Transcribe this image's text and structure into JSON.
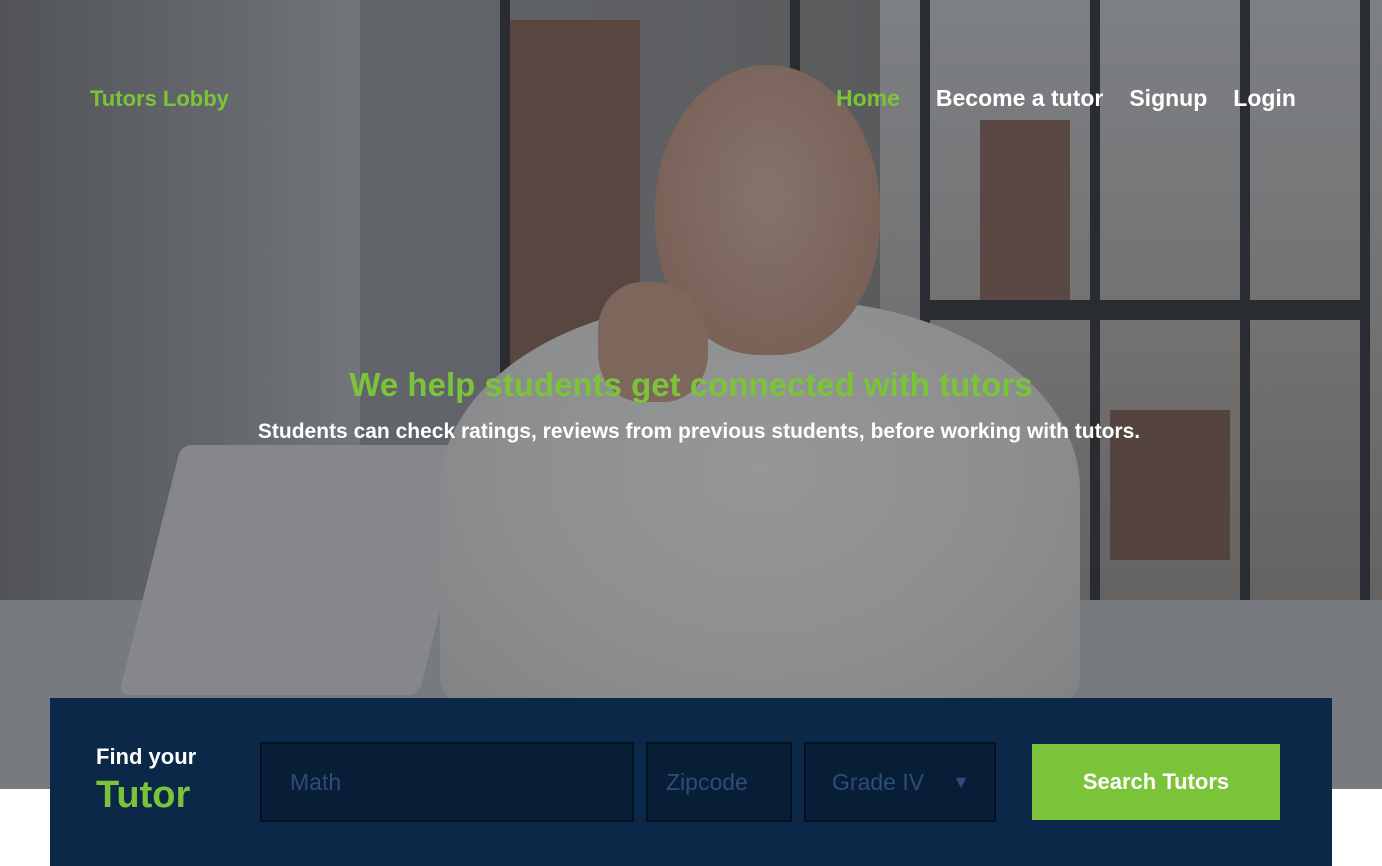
{
  "brand": {
    "name": "Tutors Lobby",
    "color": "#7bc43a"
  },
  "nav": {
    "items": [
      {
        "label": "Home",
        "active": true
      },
      {
        "label": "Become a tutor",
        "active": false
      },
      {
        "label": "Signup",
        "active": false
      },
      {
        "label": "Login",
        "active": false
      }
    ]
  },
  "hero": {
    "headline": "We help students get connected with tutors",
    "subline": "Students can check ratings, reviews from previous students, before working with tutors."
  },
  "search": {
    "find_label": "Find your",
    "find_emphasis": "Tutor",
    "subject_placeholder": "Math",
    "zip_placeholder": "Zipcode",
    "grade_value": "Grade IV",
    "caret_icon": "caret-down-icon",
    "button_label": "Search Tutors"
  },
  "colors": {
    "accent": "#7bc43a",
    "panel": "#0b2848",
    "field": "#081d36",
    "field_text": "#2d4d78"
  }
}
